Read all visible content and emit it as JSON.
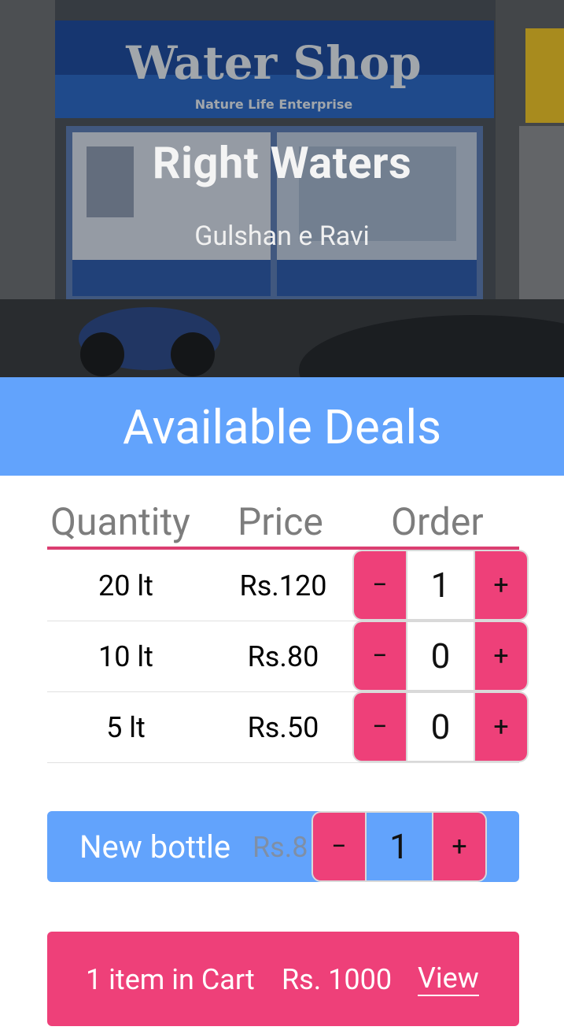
{
  "hero": {
    "store_name": "Right Waters",
    "location": "Gulshan e Ravi",
    "photo_sign_text": "Water Shop",
    "photo_sign_subtext": "Nature Life Enterprise"
  },
  "deals": {
    "title": "Available Deals",
    "columns": [
      "Quantity",
      "Price",
      "Order"
    ],
    "rows": [
      {
        "quantity": "20 lt",
        "price": "Rs.120",
        "order": "1"
      },
      {
        "quantity": "10 lt",
        "price": "Rs.80",
        "order": "0"
      },
      {
        "quantity": "5 lt",
        "price": "Rs.50",
        "order": "0"
      }
    ],
    "minus_symbol": "−",
    "plus_symbol": "+"
  },
  "new_bottle": {
    "label": "New bottle",
    "price": "Rs.8",
    "quantity": "1"
  },
  "cart": {
    "count_text": "1 item in Cart",
    "total_text": "Rs. 1000",
    "view_label": "View"
  },
  "colors": {
    "accent_blue": "#62a3fc",
    "accent_pink": "#ee4079",
    "header_rule": "#db3e71"
  }
}
